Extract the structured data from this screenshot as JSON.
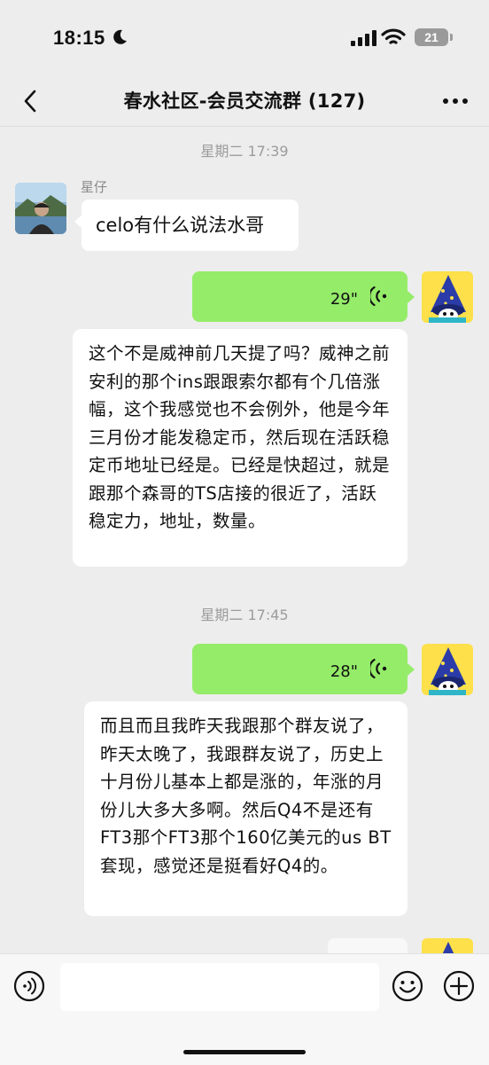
{
  "status_bar": {
    "time": "18:15",
    "battery": "21",
    "icons": [
      "moon-icon",
      "cellular-signal-icon",
      "wifi-icon",
      "battery-icon"
    ]
  },
  "nav": {
    "title": "春水社区-会员交流群 (127)",
    "back_icon": "chevron-left-icon",
    "more_icon": "more-dots-icon"
  },
  "messages": {
    "ts1": "星期二 17:39",
    "sender1": "星仔",
    "text1": "celo有什么说法水哥",
    "voice1_duration": "29\"",
    "transcript1": "这个不是威神前几天提了吗？威神之前安利的那个ins跟跟索尔都有个几倍涨幅，这个我感觉也不会例外，他是今年三月份才能发稳定币，然后现在活跃稳定币地址已经是。已经是快超过，就是跟那个森哥的TS店接的很近了，活跃稳定力，地址，数量。",
    "ts2": "星期二 17:45",
    "voice2_duration": "28\"",
    "transcript2": "而且而且我昨天我跟那个群友说了，昨天太晚了，我跟群友说了，历史上十月份儿基本上都是涨的，年涨的月份儿大多大多啊。然后Q4不是还有FT3那个FT3那个160亿美元的us BT套现，感觉还是挺看好Q4的。"
  },
  "input_bar": {
    "value": "",
    "icons": [
      "voice-mode-icon",
      "emoji-icon",
      "plus-icon"
    ]
  },
  "colors": {
    "background": "#ededed",
    "self_bubble": "#95ec69",
    "other_bubble": "#ffffff"
  }
}
